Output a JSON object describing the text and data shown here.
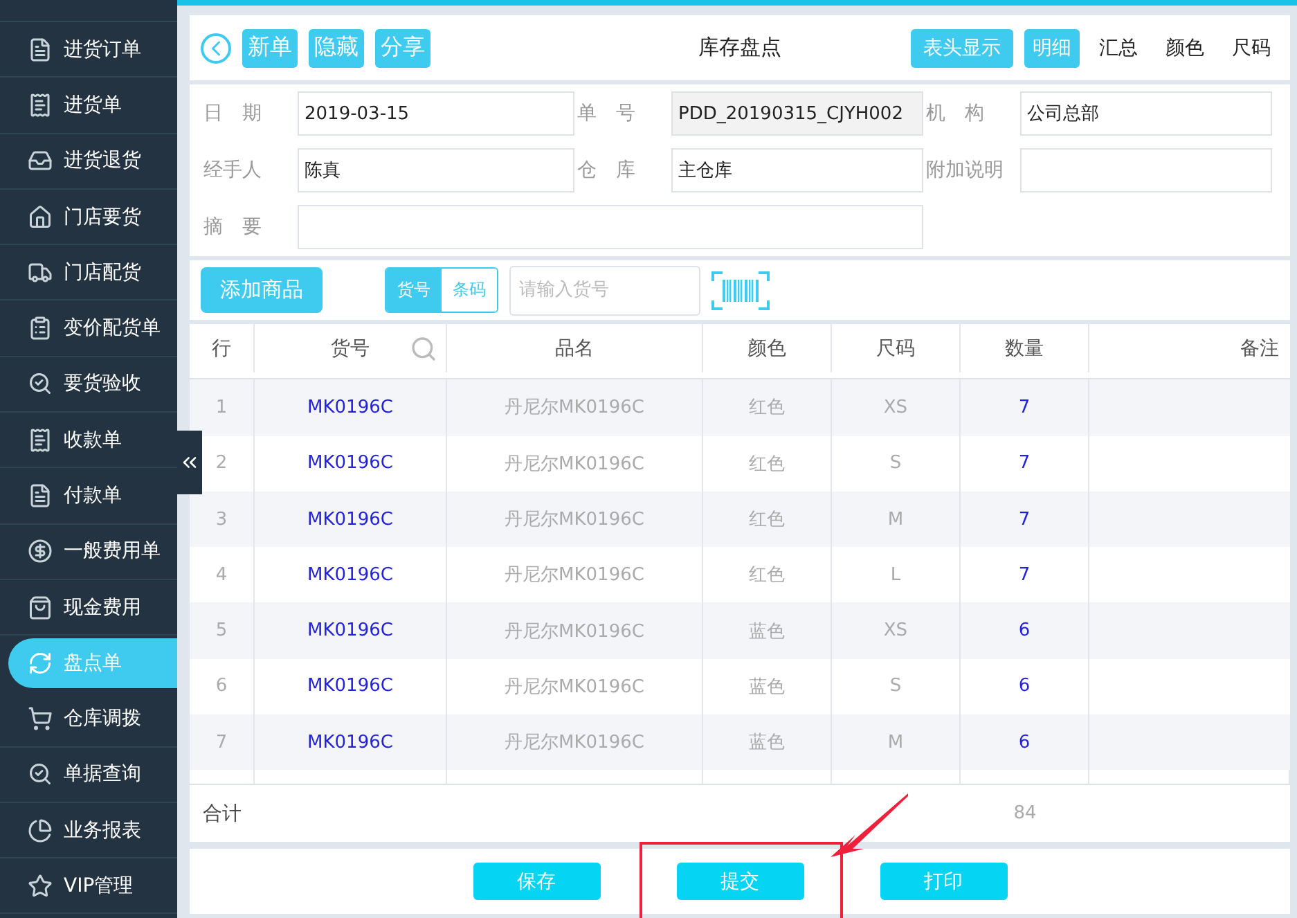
{
  "sidebar": {
    "items": [
      {
        "label": "进货订单",
        "selected": false
      },
      {
        "label": "进货单",
        "selected": false
      },
      {
        "label": "进货退货",
        "selected": false
      },
      {
        "label": "门店要货",
        "selected": false
      },
      {
        "label": "门店配货",
        "selected": false
      },
      {
        "label": "变价配货单",
        "selected": false
      },
      {
        "label": "要货验收",
        "selected": false
      },
      {
        "label": "收款单",
        "selected": false
      },
      {
        "label": "付款单",
        "selected": false
      },
      {
        "label": "一般费用单",
        "selected": false
      },
      {
        "label": "现金费用",
        "selected": false
      },
      {
        "label": "盘点单",
        "selected": true
      },
      {
        "label": "仓库调拨",
        "selected": false
      },
      {
        "label": "单据查询",
        "selected": false
      },
      {
        "label": "业务报表",
        "selected": false
      },
      {
        "label": "VIP管理",
        "selected": false
      }
    ]
  },
  "header": {
    "left_buttons": [
      "新单",
      "隐藏",
      "分享"
    ],
    "title": "库存盘点",
    "header_toggle": "表头显示",
    "view_tabs": [
      {
        "label": "明细",
        "selected": true
      },
      {
        "label": "汇总",
        "selected": false
      },
      {
        "label": "颜色",
        "selected": false
      },
      {
        "label": "尺码",
        "selected": false
      }
    ]
  },
  "form": {
    "fields": [
      {
        "label": "日　期",
        "value": "2019-03-15",
        "readonly": false
      },
      {
        "label": "单　号",
        "value": "PDD_20190315_CJYH002",
        "readonly": true
      },
      {
        "label": "机　构",
        "value": "公司总部",
        "readonly": false
      },
      {
        "label": "经手人",
        "value": "陈真",
        "readonly": false
      },
      {
        "label": "仓　库",
        "value": "主仓库",
        "readonly": false
      },
      {
        "label": "附加说明",
        "readonly": false
      }
    ],
    "summary": {
      "label": "摘　要"
    }
  },
  "toolbar": {
    "add_button": "添加商品",
    "modes": [
      {
        "label": "货号",
        "selected": true
      },
      {
        "label": "条码",
        "selected": false
      }
    ],
    "search": {
      "placeholder": "请输入货号"
    }
  },
  "table": {
    "columns": [
      "行",
      "货号",
      "品名",
      "颜色",
      "尺码",
      "数量",
      "备注"
    ],
    "rows": [
      [
        "1",
        "MK0196C",
        "丹尼尔MK0196C",
        "红色",
        "XS",
        "7",
        ""
      ],
      [
        "2",
        "MK0196C",
        "丹尼尔MK0196C",
        "红色",
        "S",
        "7",
        ""
      ],
      [
        "3",
        "MK0196C",
        "丹尼尔MK0196C",
        "红色",
        "M",
        "7",
        ""
      ],
      [
        "4",
        "MK0196C",
        "丹尼尔MK0196C",
        "红色",
        "L",
        "7",
        ""
      ],
      [
        "5",
        "MK0196C",
        "丹尼尔MK0196C",
        "蓝色",
        "XS",
        "6",
        ""
      ],
      [
        "6",
        "MK0196C",
        "丹尼尔MK0196C",
        "蓝色",
        "S",
        "6",
        ""
      ],
      [
        "7",
        "MK0196C",
        "丹尼尔MK0196C",
        "蓝色",
        "M",
        "6",
        ""
      ]
    ],
    "total": {
      "label": "合计",
      "quantity": "84"
    }
  },
  "footer_buttons": [
    {
      "label": "保存",
      "highlighted": false
    },
    {
      "label": "提交",
      "highlighted": true
    },
    {
      "label": "打印",
      "highlighted": false
    }
  ]
}
